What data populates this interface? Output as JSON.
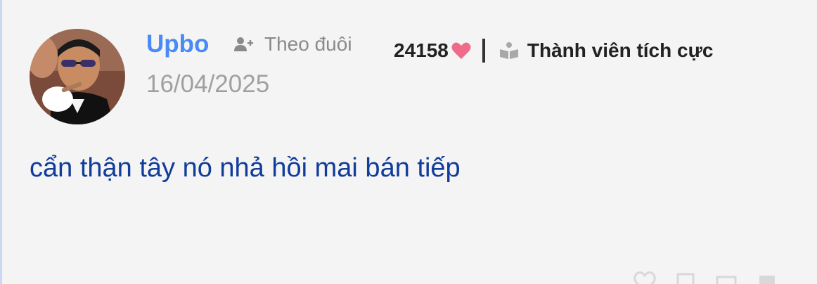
{
  "comment": {
    "author": {
      "name": "Upbo",
      "avatar_icon": "profile-photo"
    },
    "follow": {
      "label": "Theo đuôi",
      "icon": "user-plus-icon"
    },
    "stats": {
      "likes": "24158",
      "heart_icon": "heart-icon",
      "heart_color": "#f06b8a",
      "rank_icon": "book-icon",
      "rank_label": "Thành viên tích cực"
    },
    "date": "16/04/2025",
    "text": "cẩn thận tây nó nhả hồi mai bán tiếp"
  },
  "colors": {
    "background": "#f4f4f4",
    "username": "#4a8af4",
    "content": "#113c9a",
    "muted": "#8a8a8a"
  }
}
